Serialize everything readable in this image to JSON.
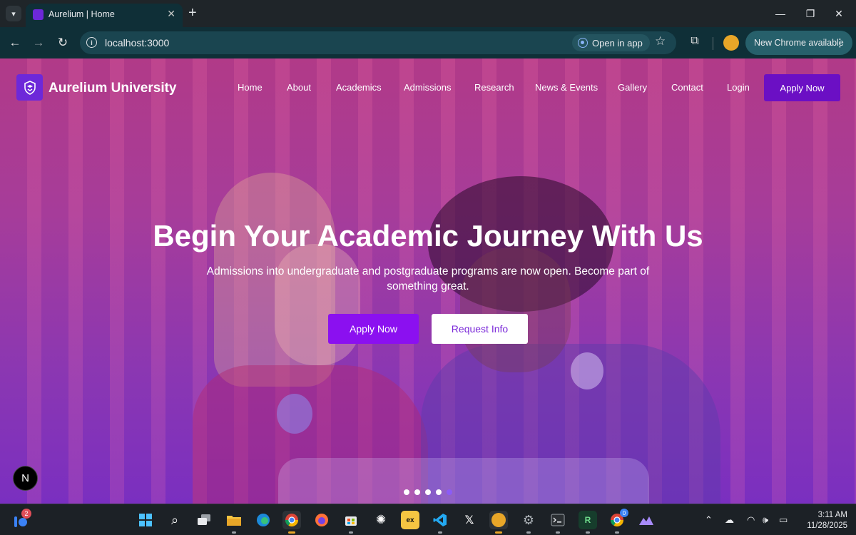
{
  "browser": {
    "tab_title": "Aurelium | Home",
    "url": "localhost:3000",
    "open_in_app": "Open in app",
    "update_label": "New Chrome available"
  },
  "site": {
    "brand": "Aurelium University",
    "nav": [
      "Home",
      "About",
      "Academics",
      "Admissions",
      "Research",
      "News & Events",
      "Gallery",
      "Contact",
      "Login"
    ],
    "nav_cta": "Apply Now"
  },
  "hero": {
    "title": "Begin Your Academic Journey With Us",
    "subtitle": "Admissions into undergraduate and postgraduate programs are now open. Become part of something great.",
    "primary_button": "Apply Now",
    "secondary_button": "Request Info",
    "slides_total": 5,
    "active_slide": 5
  },
  "next_badge": "N",
  "taskbar": {
    "widget_badge": "2",
    "chrome2_badge": "0",
    "clock_time": "3:11 AM",
    "clock_date": "11/28/2025"
  },
  "colors": {
    "brand_purple": "#6b0fc4",
    "hero_overlay": "#9a3aa2",
    "button_primary": "#8b10f0",
    "chrome_toolbar": "#0f2f37"
  },
  "icons": [
    "tab-search-icon",
    "favicon-icon",
    "close-icon",
    "new-tab-icon",
    "minimize-icon",
    "maximize-icon",
    "window-close-icon",
    "back-icon",
    "forward-icon",
    "reload-icon",
    "info-icon",
    "react-icon",
    "star-icon",
    "extensions-icon",
    "profile-avatar",
    "menu-icon",
    "crest-icon"
  ]
}
